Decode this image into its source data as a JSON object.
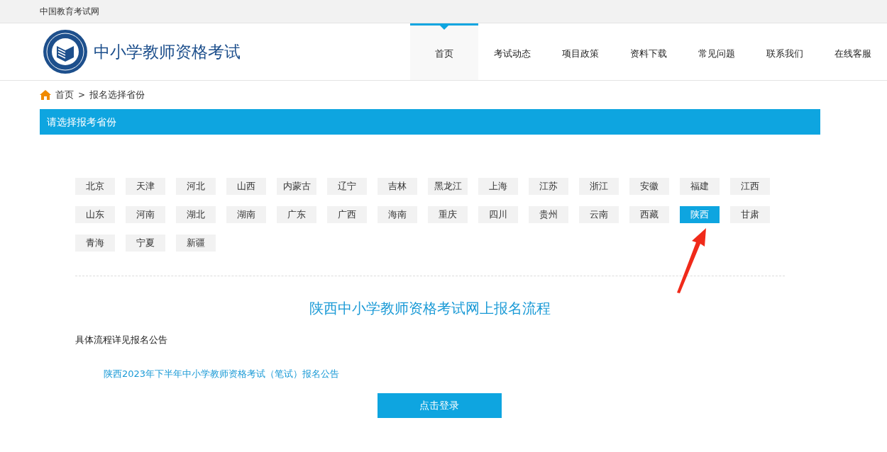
{
  "top_bar": {
    "site_name": "中国教育考试网"
  },
  "header": {
    "title": "中小学教师资格考试"
  },
  "nav": [
    {
      "label": "首页",
      "selected": true
    },
    {
      "label": "考试动态",
      "selected": false
    },
    {
      "label": "项目政策",
      "selected": false
    },
    {
      "label": "资料下载",
      "selected": false
    },
    {
      "label": "常见问题",
      "selected": false
    },
    {
      "label": "联系我们",
      "selected": false
    },
    {
      "label": "在线客服",
      "selected": false
    }
  ],
  "breadcrumb": {
    "home": "首页",
    "separator": ">",
    "current": "报名选择省份"
  },
  "panel": {
    "title": "请选择报考省份"
  },
  "provinces": [
    {
      "label": "北京",
      "selected": false
    },
    {
      "label": "天津",
      "selected": false
    },
    {
      "label": "河北",
      "selected": false
    },
    {
      "label": "山西",
      "selected": false
    },
    {
      "label": "内蒙古",
      "selected": false
    },
    {
      "label": "辽宁",
      "selected": false
    },
    {
      "label": "吉林",
      "selected": false
    },
    {
      "label": "黑龙江",
      "selected": false
    },
    {
      "label": "上海",
      "selected": false
    },
    {
      "label": "江苏",
      "selected": false
    },
    {
      "label": "浙江",
      "selected": false
    },
    {
      "label": "安徽",
      "selected": false
    },
    {
      "label": "福建",
      "selected": false
    },
    {
      "label": "江西",
      "selected": false
    },
    {
      "label": "山东",
      "selected": false
    },
    {
      "label": "河南",
      "selected": false
    },
    {
      "label": "湖北",
      "selected": false
    },
    {
      "label": "湖南",
      "selected": false
    },
    {
      "label": "广东",
      "selected": false
    },
    {
      "label": "广西",
      "selected": false
    },
    {
      "label": "海南",
      "selected": false
    },
    {
      "label": "重庆",
      "selected": false
    },
    {
      "label": "四川",
      "selected": false
    },
    {
      "label": "贵州",
      "selected": false
    },
    {
      "label": "云南",
      "selected": false
    },
    {
      "label": "西藏",
      "selected": false
    },
    {
      "label": "陕西",
      "selected": true
    },
    {
      "label": "甘肃",
      "selected": false
    },
    {
      "label": "青海",
      "selected": false
    },
    {
      "label": "宁夏",
      "selected": false
    },
    {
      "label": "新疆",
      "selected": false
    }
  ],
  "process": {
    "heading": "陕西中小学教师资格考试网上报名流程",
    "note": "具体流程详见报名公告",
    "link": "陕西2023年下半年中小学教师资格考试（笔试）报名公告",
    "button": "点击登录"
  }
}
